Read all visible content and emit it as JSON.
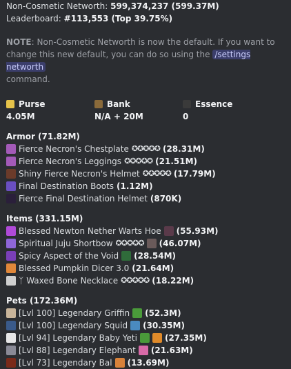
{
  "header": {
    "networth_label": "Non-Cosmetic Networth:",
    "networth_value": "599,374,237 (599.37M)",
    "leaderboard_label": "Leaderboard:",
    "leaderboard_value": "#113,553 (Top 39.75%)"
  },
  "note": {
    "label": "NOTE",
    "text": ": Non-Cosmetic Networth is now the default. If you want to change this new default, you can do so using the ",
    "command": "/settings networth",
    "tail": "command."
  },
  "stats": [
    {
      "label": "Purse",
      "value": "4.05M",
      "icon": "gold-ingot-icon",
      "color": "#e6c34a"
    },
    {
      "label": "Bank",
      "value": "N/A + 20M",
      "icon": "chest-icon",
      "color": "#8a6a3a"
    },
    {
      "label": "Essence",
      "value": "0",
      "icon": "wither-skull-icon",
      "color": "#3a3a3a"
    }
  ],
  "armor": {
    "title": "Armor (71.82M)",
    "items": [
      {
        "name": "Fierce Necron's Chestplate",
        "stars": "✪✪✪✪✪",
        "value": "(28.31M)",
        "icon": "chestplate-icon",
        "color": "#a35ab8"
      },
      {
        "name": "Fierce Necron's Leggings",
        "stars": "✪✪✪✪✪",
        "value": "(21.51M)",
        "icon": "leggings-icon",
        "color": "#a35ab8"
      },
      {
        "name": "Shiny Fierce Necron's Helmet",
        "stars": "✪✪✪✪✪",
        "value": "(17.79M)",
        "icon": "helmet-icon",
        "color": "#6b3b2a"
      },
      {
        "name": "Final Destination Boots",
        "stars": "",
        "value": "(1.12M)",
        "icon": "boots-icon",
        "color": "#6a4fc0"
      },
      {
        "name": "Fierce Final Destination Helmet",
        "stars": "",
        "value": "(870K)",
        "icon": "enderman-head-icon",
        "color": "#2a1f3a"
      }
    ]
  },
  "items": {
    "title": "Items (331.15M)",
    "items": [
      {
        "name": "Blessed Newton Nether Warts Hoe",
        "extra_icon": "nether-wart-block-icon",
        "extra_color": "#5a3a4a",
        "value": "(55.93M)",
        "icon": "hoe-icon",
        "color": "#b04ad8"
      },
      {
        "name": "Spiritual Juju Shortbow",
        "stars": "✪✪✪✪✪",
        "extra_icon": "soul-block-icon",
        "extra_color": "#6a5a5a",
        "value": "(46.07M)",
        "icon": "bow-icon",
        "color": "#8f66d8"
      },
      {
        "name": "Spicy Aspect of the Void",
        "extra_icon": "green-gem-icon",
        "extra_color": "#2f6b3a",
        "value": "(28.54M)",
        "icon": "shovel-icon",
        "color": "#7a3fb8"
      },
      {
        "name": "Blessed Pumpkin Dicer 3.0",
        "value": "(21.64M)",
        "icon": "axe-icon",
        "color": "#e0873a"
      },
      {
        "name": "Waxed Bone Necklace",
        "stars": "✪✪✪✪✪",
        "prefix": "ᛉ",
        "value": "(18.22M)",
        "icon": "bone-necklace-icon",
        "color": "#cfcfcf"
      }
    ]
  },
  "pets": {
    "title": "Pets (172.36M)",
    "items": [
      {
        "name": "[Lvl 100] Legendary Griffin",
        "extra_icon": "green-block-icon",
        "extra_color": "#4a9a3a",
        "value": "(52.3M)",
        "icon": "griffin-head-icon",
        "color": "#c8b49a"
      },
      {
        "name": "[Lvl 100] Legendary Squid",
        "extra_icon": "fishing-rod-icon",
        "extra_color": "#4a8ac0",
        "value": "(30.35M)",
        "icon": "squid-head-icon",
        "color": "#3a5a8a"
      },
      {
        "name": "[Lvl 94] Legendary Baby Yeti",
        "extra_icon": "green-block-icon",
        "extra_color": "#4a9a3a",
        "extra_icon2": "carrot-icon",
        "extra_color2": "#e08a2a",
        "value": "(27.35M)",
        "icon": "yeti-head-icon",
        "color": "#e6e6e6"
      },
      {
        "name": "[Lvl 88] Legendary Elephant",
        "extra_icon": "pink-tool-icon",
        "extra_color": "#d86aa8",
        "value": "(21.63M)",
        "icon": "elephant-head-icon",
        "color": "#8a8a96"
      },
      {
        "name": "[Lvl 73] Legendary Bal",
        "extra_icon": "orange-block-icon",
        "extra_color": "#d8823a",
        "value": "(13.69M)",
        "icon": "bal-head-icon",
        "color": "#7a2a1a"
      }
    ]
  }
}
